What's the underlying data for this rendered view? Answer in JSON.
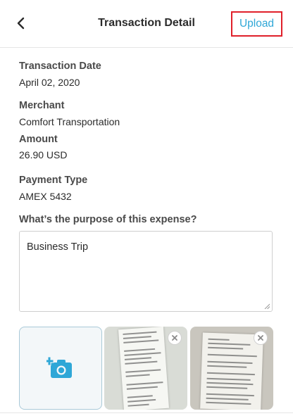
{
  "header": {
    "title": "Transaction Detail",
    "upload_label": "Upload",
    "back_icon": "chevron-left-icon"
  },
  "fields": {
    "transaction_date": {
      "label": "Transaction Date",
      "value": "April 02, 2020"
    },
    "merchant": {
      "label": "Merchant",
      "value": "Comfort Transportation"
    },
    "amount": {
      "label": "Amount",
      "value": "26.90 USD"
    },
    "payment_type": {
      "label": "Payment Type",
      "value": "AMEX 5432"
    }
  },
  "purpose": {
    "question": "What’s the purpose of this expense?",
    "value": "Business Trip"
  },
  "attachments": {
    "add_icon": "add-photo-camera-icon",
    "remove_icon": "close-icon",
    "items": [
      "receipt-1",
      "receipt-2"
    ]
  },
  "colors": {
    "accent": "#2fa7d7",
    "highlight_border": "#e0202a",
    "label": "#4a4a4a",
    "text": "#2b2b2b"
  }
}
